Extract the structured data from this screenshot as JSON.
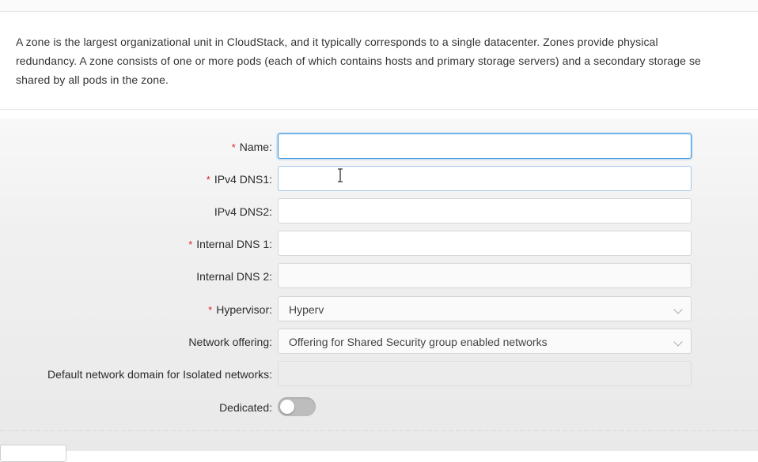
{
  "description": {
    "line1": "A zone is the largest organizational unit in CloudStack, and it typically corresponds to a single datacenter. Zones provide physical",
    "line2": "redundancy. A zone consists of one or more pods (each of which contains hosts and primary storage servers) and a secondary storage se",
    "line3": "shared by all pods in the zone."
  },
  "form": {
    "name": {
      "label": "Name",
      "required": true,
      "value": ""
    },
    "ipv4_dns1": {
      "label": "IPv4 DNS1",
      "required": true,
      "value": ""
    },
    "ipv4_dns2": {
      "label": "IPv4 DNS2",
      "required": false,
      "value": ""
    },
    "internal_dns1": {
      "label": "Internal DNS 1",
      "required": true,
      "value": ""
    },
    "internal_dns2": {
      "label": "Internal DNS 2",
      "required": false,
      "value": ""
    },
    "hypervisor": {
      "label": "Hypervisor",
      "required": true,
      "value": "Hyperv"
    },
    "network_offering": {
      "label": "Network offering",
      "required": false,
      "value": "Offering for Shared Security group enabled networks"
    },
    "default_domain": {
      "label": "Default network domain for Isolated networks",
      "required": false,
      "value": ""
    },
    "dedicated": {
      "label": "Dedicated",
      "required": false,
      "on": false
    }
  },
  "colon": ":",
  "required_mark": "*",
  "colors": {
    "required": "#e0242b",
    "focus": "#2c8fe0",
    "toggle_off": "#bdbdbd"
  },
  "icons": [
    "chevron-down-icon",
    "text-cursor-icon"
  ]
}
